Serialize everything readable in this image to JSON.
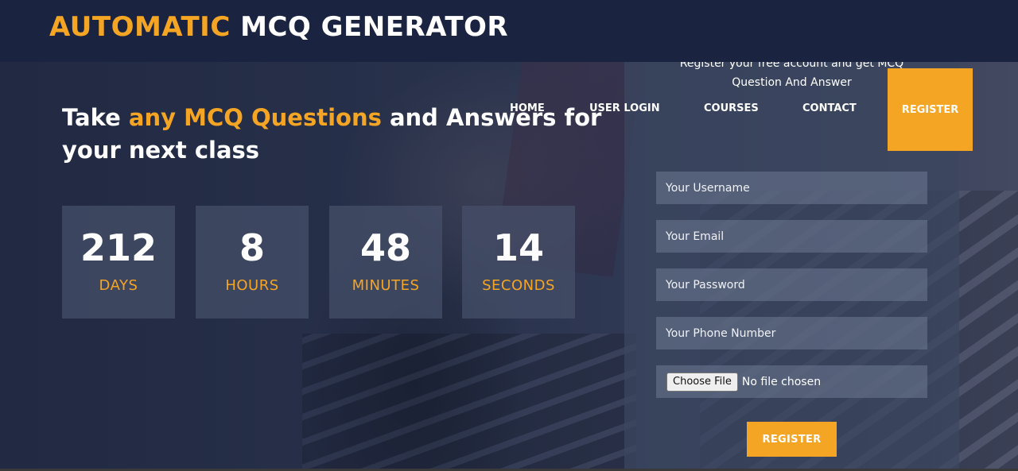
{
  "brand": {
    "accent_word": "AUTOMATIC",
    "rest": " MCQ GENERATOR"
  },
  "nav": {
    "items": [
      {
        "label": "HOME"
      },
      {
        "label": "USER LOGIN"
      },
      {
        "label": "COURSES"
      },
      {
        "label": "CONTACT"
      }
    ],
    "register_label": "REGISTER"
  },
  "hero": {
    "pre": "Take ",
    "accent": "any MCQ Questions",
    "post": " and Answers for your next class"
  },
  "countdown": [
    {
      "value": "212",
      "label": "DAYS"
    },
    {
      "value": "8",
      "label": "HOURS"
    },
    {
      "value": "48",
      "label": "MINUTES"
    },
    {
      "value": "14",
      "label": "SECONDS"
    }
  ],
  "register_form": {
    "intro_line1": "Register your free account and get MCQ",
    "intro_line2": "Question And Answer",
    "username_placeholder": "Your Username",
    "email_placeholder": "Your Email",
    "password_placeholder": "Your Password",
    "phone_placeholder": "Your Phone Number",
    "file_button": "Choose File",
    "file_status": "No file chosen",
    "submit_label": "REGISTER"
  },
  "colors": {
    "accent": "#f5a524",
    "header_bg": "#1a2340"
  }
}
